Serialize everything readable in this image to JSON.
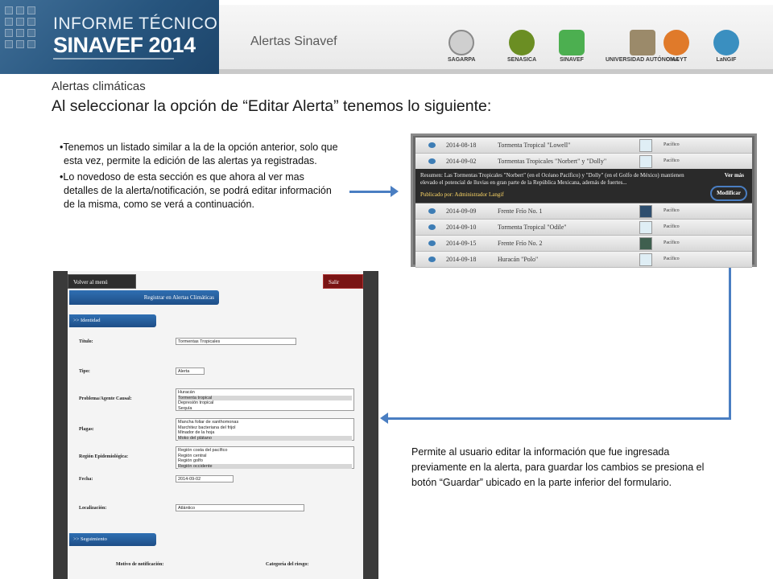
{
  "header": {
    "banner_line1": "INFORME TÉCNICO",
    "banner_line2": "SINAVEF 2014",
    "title": "Alertas Sinavef",
    "logos": [
      {
        "name": "sagarpa",
        "label": "SAGARPA",
        "color": "#8a8a8a"
      },
      {
        "name": "senasica",
        "label": "SENASICA",
        "color": "#6b8e23"
      },
      {
        "name": "comite",
        "label": "SINAVEF",
        "color": "#4caf50"
      },
      {
        "name": "uaslp",
        "label": "UNIVERSIDAD AUTÓNOMA",
        "color": "#7a6a4a"
      },
      {
        "name": "conacyt",
        "label": "CIACYT",
        "color": "#e07a2a"
      },
      {
        "name": "langif",
        "label": "LaNGIF",
        "color": "#3a8fc0"
      }
    ]
  },
  "subtitle": "Alertas climáticas",
  "main_title": "Al seleccionar la opción de “Editar Alerta” tenemos lo siguiente:",
  "bullets": [
    "Tenemos un listado similar a la de la opción anterior, solo que esta vez, permite la edición de las alertas ya registradas.",
    "Lo novedoso de esta sección es que ahora al ver mas detalles de la alerta/notificación, se podrá editar información de la misma, como se verá a continuación."
  ],
  "alerts": {
    "rows_top": [
      {
        "date": "2014-08-18",
        "name": "Tormenta Tropical \"Lowell\"",
        "region": "Pacífico"
      },
      {
        "date": "2014-09-02",
        "name": "Tormentas Tropicales \"Norbert\" y \"Dolly\"",
        "region": "Pacífico"
      }
    ],
    "detail_text": "Resumen: Las Tormentas Tropicales \"Norbert\" (en el Océano Pacífico) y \"Dolly\" (en el Golfo de México) mantienen elevado el potencial de lluvias en gran parte de la República Mexicana, además de fuertes...",
    "detail_published": "Publicado por: Administrador Langif",
    "ver_mas": "Ver más",
    "modificar": "Modificar",
    "rows_bottom": [
      {
        "date": "2014-09-09",
        "name": "Frente Frío No. 1",
        "region": "Pacífico"
      },
      {
        "date": "2014-09-10",
        "name": "Tormenta Tropical \"Odile\"",
        "region": "Pacífico"
      },
      {
        "date": "2014-09-15",
        "name": "Frente Frío No. 2",
        "region": "Pacífico"
      },
      {
        "date": "2014-09-18",
        "name": "Huracán \"Polo\"",
        "region": "Pacífico"
      }
    ]
  },
  "form": {
    "back": "Volver al menú",
    "exit": "Salir",
    "register": "Registrar en Alertas Climáticas",
    "section_identity": ">> Identidad",
    "section_follow": ">> Seguimiento",
    "title_label": "Título:",
    "title_value": "Tormentas Tropicales",
    "type_label": "Tipo:",
    "type_value": "Alerta",
    "problem_label": "Problema/Agente Causal:",
    "problem_options": [
      "Huracán",
      "Tormenta tropical",
      "Depresión tropical",
      "Sequía"
    ],
    "pests_label": "Plagas:",
    "pests_options": [
      "Mancha foliar de xanthomonas",
      "Marchitez bacteriana del frijol",
      "Minador de la hoja",
      "Moko del plátano"
    ],
    "region_label": "Región Epidemiológica:",
    "region_options": [
      "Región costa del pacífico",
      "Región central",
      "Región golfo",
      "Región occidente"
    ],
    "date_label": "Fecha:",
    "date_value": "2014-09-02",
    "location_label": "Localización:",
    "location_value": "Atlántico",
    "motivo_label": "Motivo de notificación:",
    "categoria_label": "Categoría del riesgo:"
  },
  "description": "Permite al usuario editar la información que fue ingresada previamente en la alerta, para guardar los cambios se presiona el botón  “Guardar” ubicado en la parte inferior del formulario."
}
